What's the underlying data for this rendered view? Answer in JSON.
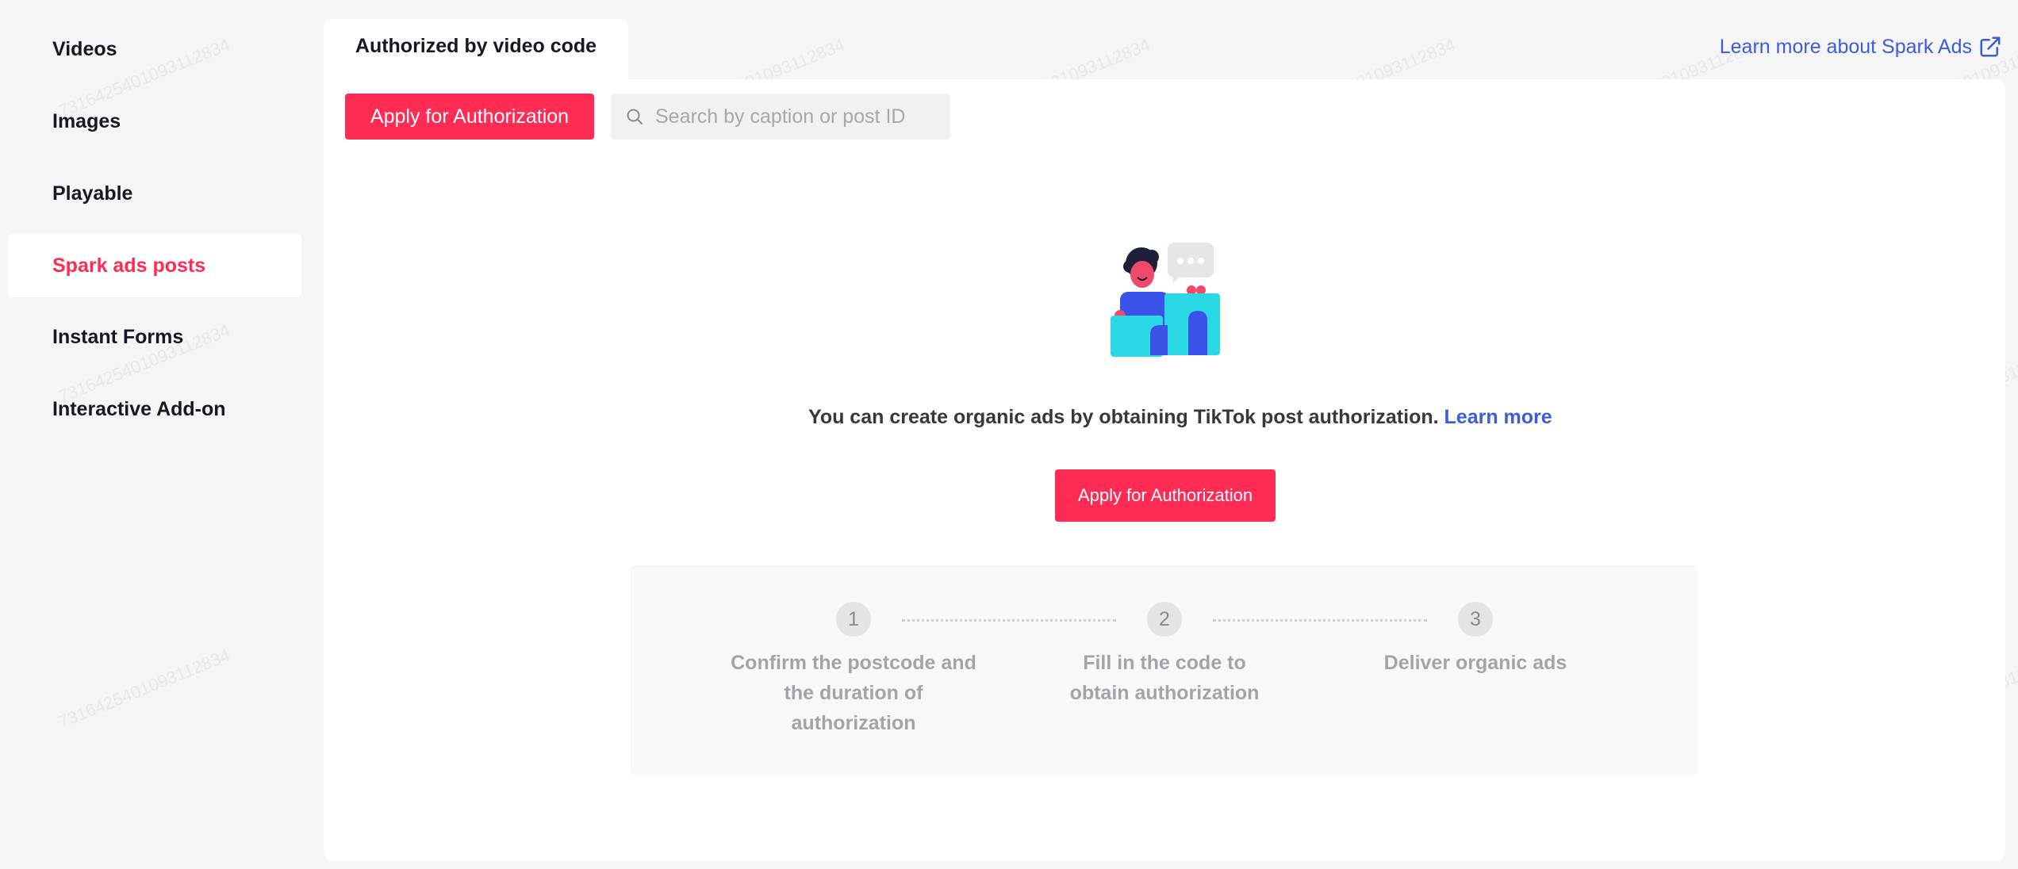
{
  "sidebar": {
    "items": [
      {
        "label": "Videos"
      },
      {
        "label": "Images"
      },
      {
        "label": "Playable"
      },
      {
        "label": "Spark ads posts",
        "active": true
      },
      {
        "label": "Instant Forms"
      },
      {
        "label": "Interactive Add-on"
      }
    ]
  },
  "tab": {
    "label": "Authorized by video code"
  },
  "header": {
    "learn_more": "Learn more about Spark Ads",
    "learn_more_icon": "external-link-icon"
  },
  "toolbar": {
    "apply_label": "Apply for Authorization",
    "search_placeholder": "Search by caption or post ID",
    "search_icon": "search-icon"
  },
  "empty_state": {
    "illustration": "person-with-chat-bubble-illustration",
    "text": "You can create organic ads by obtaining TikTok post authorization.",
    "link": "Learn more",
    "button_label": "Apply for Authorization"
  },
  "steps": [
    {
      "number": "1",
      "label": "Confirm the postcode and the duration of authorization"
    },
    {
      "number": "2",
      "label": "Fill in the code to obtain authorization"
    },
    {
      "number": "3",
      "label": "Deliver organic ads"
    }
  ],
  "watermark": "7316425401093112834",
  "colors": {
    "accent": "#fe2c55",
    "link": "#3c5cdb",
    "background": "#f5f5f6",
    "panel": "#ffffff"
  }
}
